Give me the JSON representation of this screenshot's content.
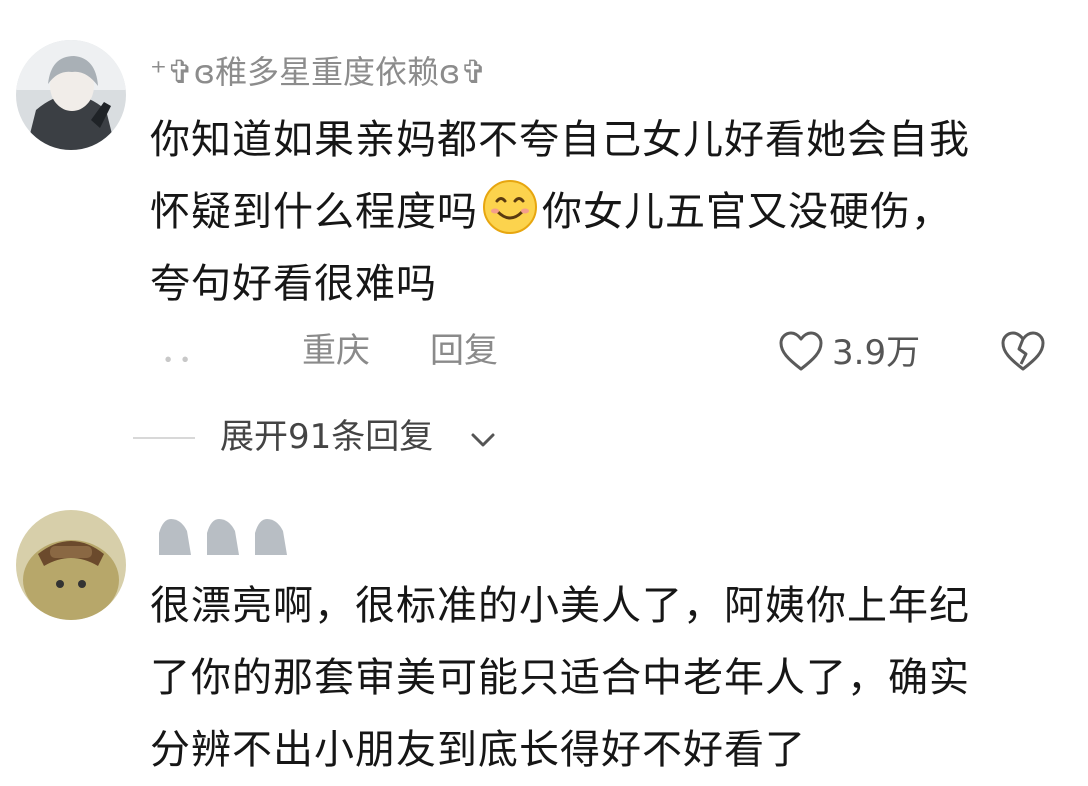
{
  "comment1": {
    "username": "⁺✞ɞ稚多星重度依赖ɞ✞",
    "lines": [
      "你知道如果亲妈都不夸自己女儿好看她会自我",
      "怀疑到什么程度吗",
      "你女儿五官又没硬伤，",
      "夸句好看很难吗"
    ],
    "time": "．．",
    "location": "重庆",
    "reply_label": "回复",
    "like_count": "3.9万",
    "expand_label": "展开91条回复"
  },
  "comment2": {
    "lines": [
      "很漂亮啊，很标准的小美人了，阿姨你上年纪",
      "了你的那套审美可能只适合中老年人了，确实",
      "分辨不出小朋友到底长得好不好看了"
    ]
  }
}
